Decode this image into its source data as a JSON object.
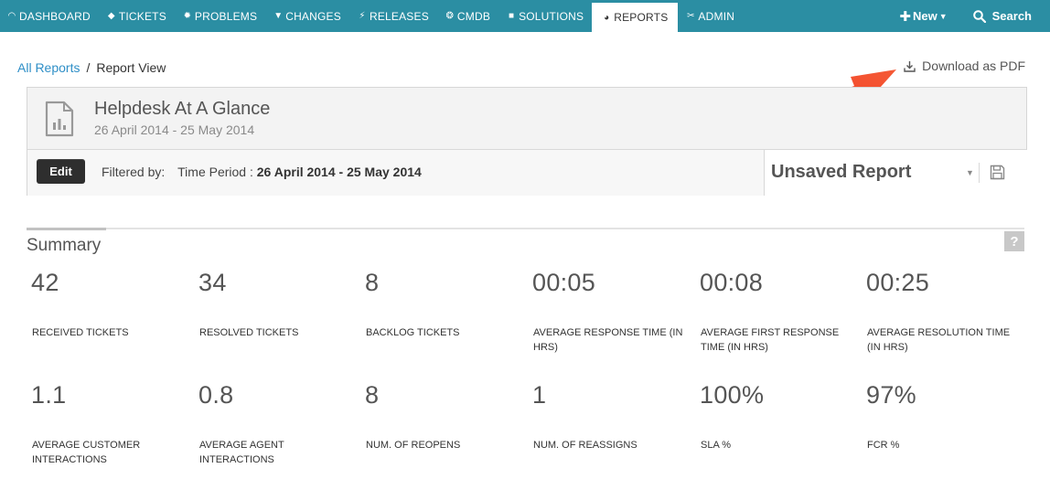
{
  "nav": {
    "items": [
      {
        "label": "DASHBOARD",
        "icon": "gauge-icon"
      },
      {
        "label": "TICKETS",
        "icon": "ticket-icon"
      },
      {
        "label": "PROBLEMS",
        "icon": "bug-icon"
      },
      {
        "label": "CHANGES",
        "icon": "shield-icon"
      },
      {
        "label": "RELEASES",
        "icon": "bolt-icon"
      },
      {
        "label": "CMDB",
        "icon": "cubes-icon"
      },
      {
        "label": "SOLUTIONS",
        "icon": "book-icon"
      },
      {
        "label": "REPORTS",
        "icon": "pie-icon",
        "active": true
      },
      {
        "label": "ADMIN",
        "icon": "tools-icon"
      }
    ],
    "new_label": "New",
    "search_label": "Search",
    "bg_color": "#2b8ea3"
  },
  "breadcrumb": {
    "parent": "All Reports",
    "sep": "/",
    "current": "Report View"
  },
  "download_label": "Download as PDF",
  "report": {
    "title": "Helpdesk At A Glance",
    "date_range": "26 April 2014 - 25 May 2014",
    "edit_label": "Edit",
    "filtered_by": "Filtered by:",
    "period_label": "Time Period :",
    "period_value": "26 April 2014 - 25 May 2014",
    "saved_report": "Unsaved Report"
  },
  "summary": {
    "title": "Summary",
    "help": "?",
    "metrics": [
      {
        "value": "42",
        "label": "RECEIVED TICKETS"
      },
      {
        "value": "34",
        "label": "RESOLVED TICKETS"
      },
      {
        "value": "8",
        "label": "BACKLOG TICKETS"
      },
      {
        "value": "00:05",
        "label": "AVERAGE RESPONSE TIME (IN HRS)"
      },
      {
        "value": "00:08",
        "label": "AVERAGE FIRST RESPONSE TIME (IN HRS)"
      },
      {
        "value": "00:25",
        "label": "AVERAGE RESOLUTION TIME (IN HRS)"
      },
      {
        "value": "1.1",
        "label": "AVERAGE CUSTOMER INTERACTIONS"
      },
      {
        "value": "0.8",
        "label": "AVERAGE AGENT INTERACTIONS"
      },
      {
        "value": "8",
        "label": "NUM. OF REOPENS"
      },
      {
        "value": "1",
        "label": "NUM. OF REASSIGNS"
      },
      {
        "value": "100%",
        "label": "SLA %"
      },
      {
        "value": "97%",
        "label": "FCR %"
      }
    ]
  },
  "annotation_arrow_color": "#f2452a"
}
